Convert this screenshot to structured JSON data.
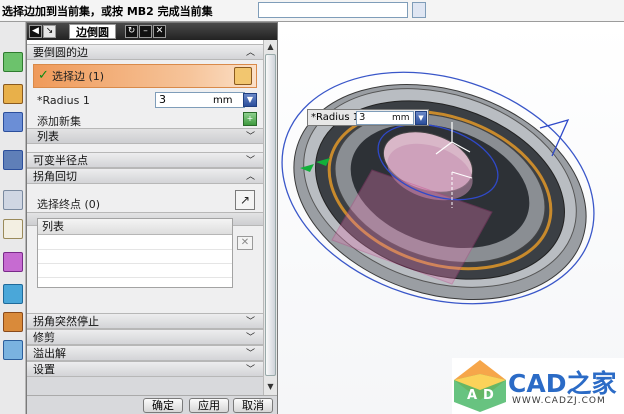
{
  "status_bar": {
    "message": "选择边加到当前集，或按 MB2 完成当前集"
  },
  "dialog": {
    "title": "边倒圆",
    "sections": {
      "edges": "要倒圆的边",
      "variable": "可变半径点",
      "corner": "拐角回切",
      "stop": "拐角突然停止",
      "trim": "修剪",
      "overflow": "溢出解",
      "settings": "设置"
    },
    "select_edge_label": "选择边 (1)",
    "radius_label": "*Radius 1",
    "radius_value": "3",
    "radius_unit": "mm",
    "add_new_set": "添加新集",
    "list_label": "列表",
    "select_endpoint_label": "选择终点 (0)",
    "endpoint_list_header": "列表",
    "buttons": {
      "ok": "确定",
      "apply": "应用",
      "cancel": "取消"
    }
  },
  "floating_radius": {
    "label": "*Radius 1",
    "value": "3",
    "unit": "mm"
  },
  "watermark": {
    "text": "CAD之家",
    "url": "WWW.CADZJ.COM"
  },
  "colors": {
    "selection_orange": "#ef9a5a",
    "model_gray": "#8d9196",
    "accent_blue": "#2b6bc6"
  }
}
